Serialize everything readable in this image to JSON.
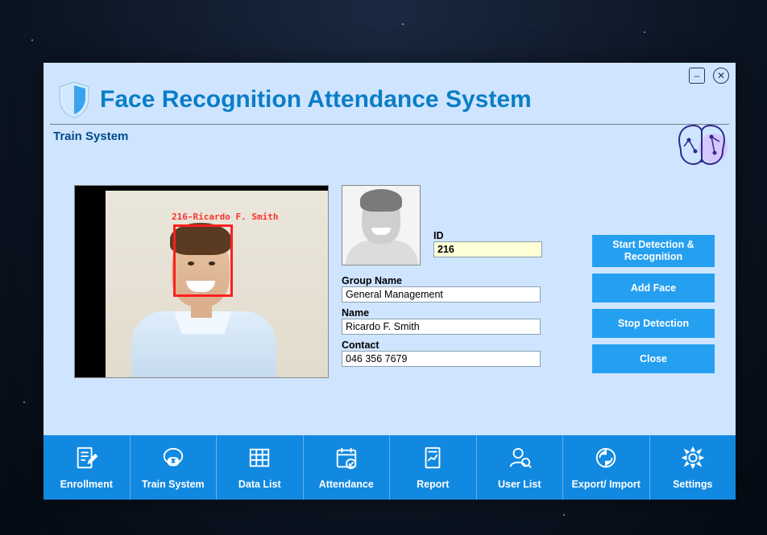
{
  "app": {
    "title": "Face Recognition Attendance System"
  },
  "section": {
    "title": "Train System"
  },
  "detection": {
    "overlay_label": "216-Ricardo F. Smith"
  },
  "form": {
    "id_label": "ID",
    "id_value": "216",
    "group_label": "Group Name",
    "group_value": "General Management",
    "name_label": "Name",
    "name_value": "Ricardo F. Smith",
    "contact_label": "Contact",
    "contact_value": "046 356 7679"
  },
  "buttons": {
    "start": "Start Detection & Recognition",
    "add_face": "Add Face",
    "stop": "Stop Detection",
    "close": "Close"
  },
  "nav": {
    "enrollment": "Enrollment",
    "train": "Train System",
    "datalist": "Data List",
    "attendance": "Attendance",
    "report": "Report",
    "userlist": "User List",
    "export": "Export/ Import",
    "settings": "Settings"
  }
}
